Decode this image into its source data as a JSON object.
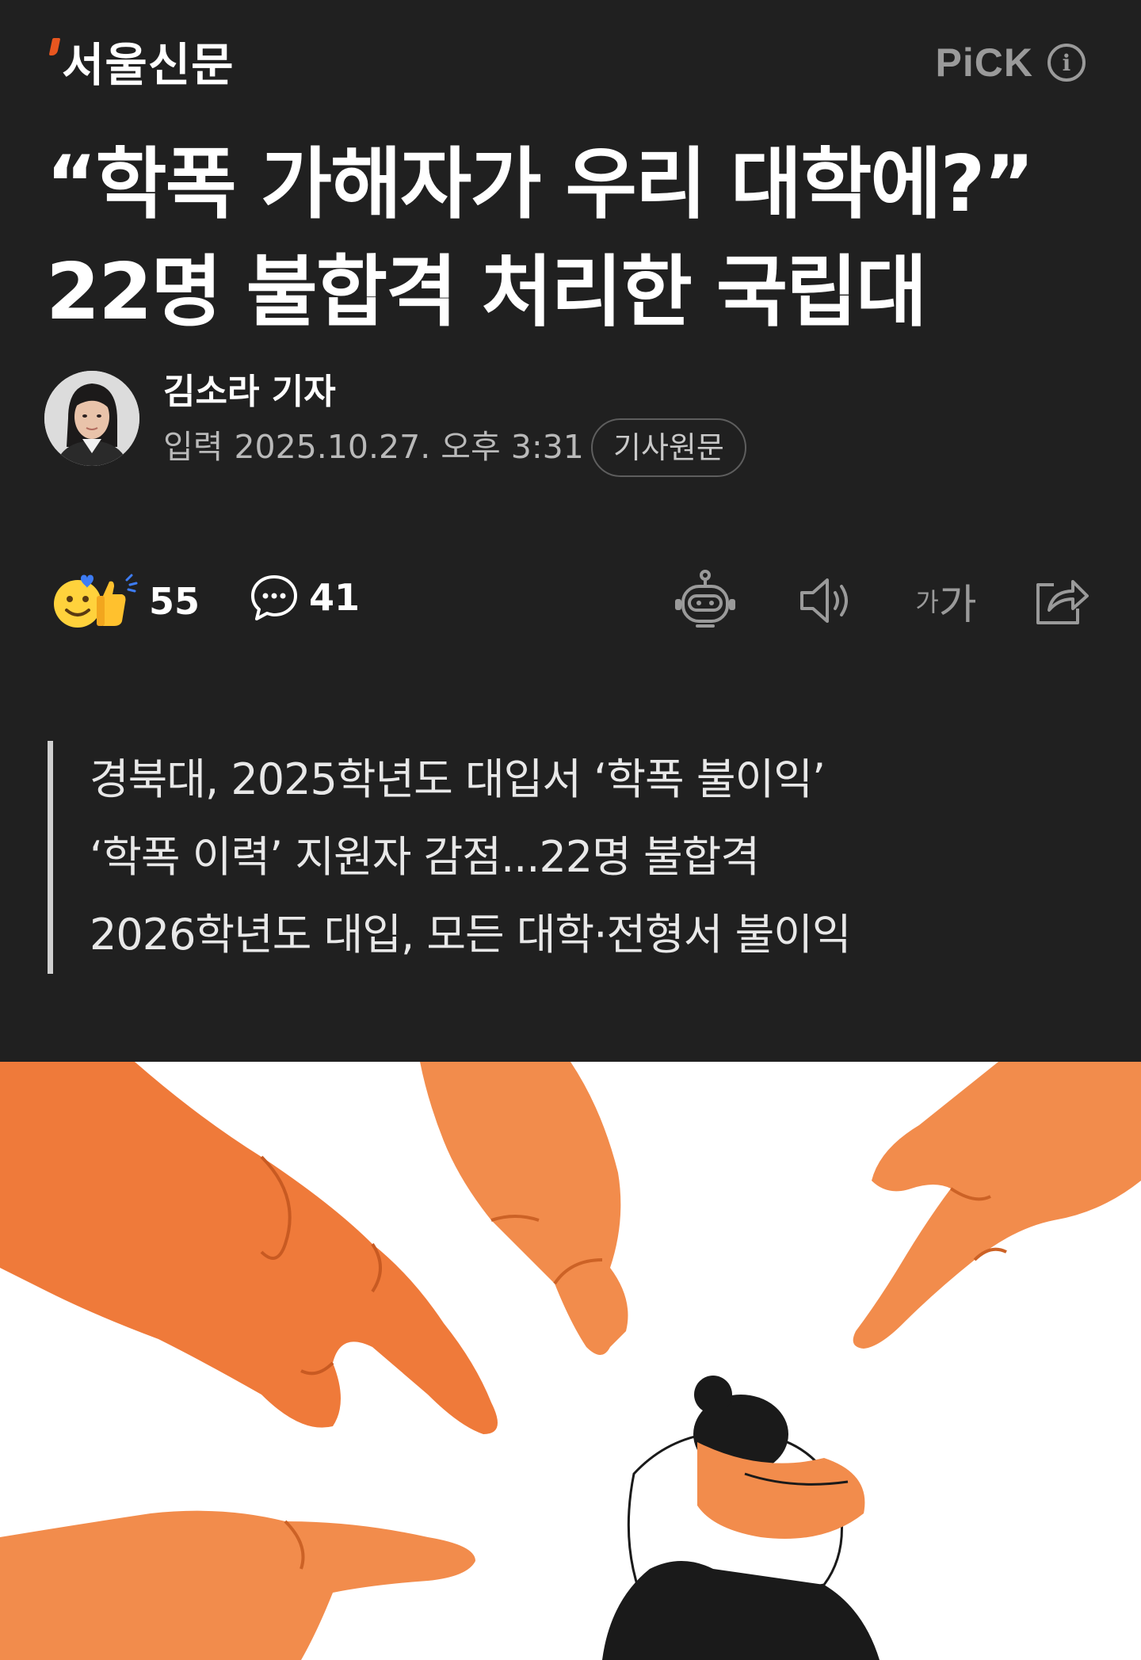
{
  "header": {
    "press_name": "서울신문",
    "pick_label": "PiCK",
    "info_icon": "info-icon"
  },
  "article": {
    "headline": "“학폭 가해자가 우리 대학에?” 22명 불합격 처리한 국립대",
    "reporter": "김소라 기자",
    "published_label": "입력",
    "published_time": "2025.10.27. 오후 3:31",
    "origin_button": "기사원문"
  },
  "actions": {
    "reaction_count": "55",
    "comment_count": "41",
    "icons": [
      "reaction-emoji-icon",
      "comment-icon",
      "ai-bot-icon",
      "speaker-icon",
      "font-size-icon",
      "share-icon"
    ],
    "font_size_small": "가",
    "font_size_big": "가"
  },
  "summary": [
    "경북대, 2025학년도 대입서 ‘학폭 불이익’",
    "‘학폭 이력’ 지원자 감점...22명 불합격",
    "2026학년도 대입, 모든 대학·전형서 불이익"
  ],
  "colors": {
    "background": "#202020",
    "brand_accent": "#e8561f",
    "hand_orange": "#f08c4f",
    "muted_text": "#b9b9b9"
  }
}
